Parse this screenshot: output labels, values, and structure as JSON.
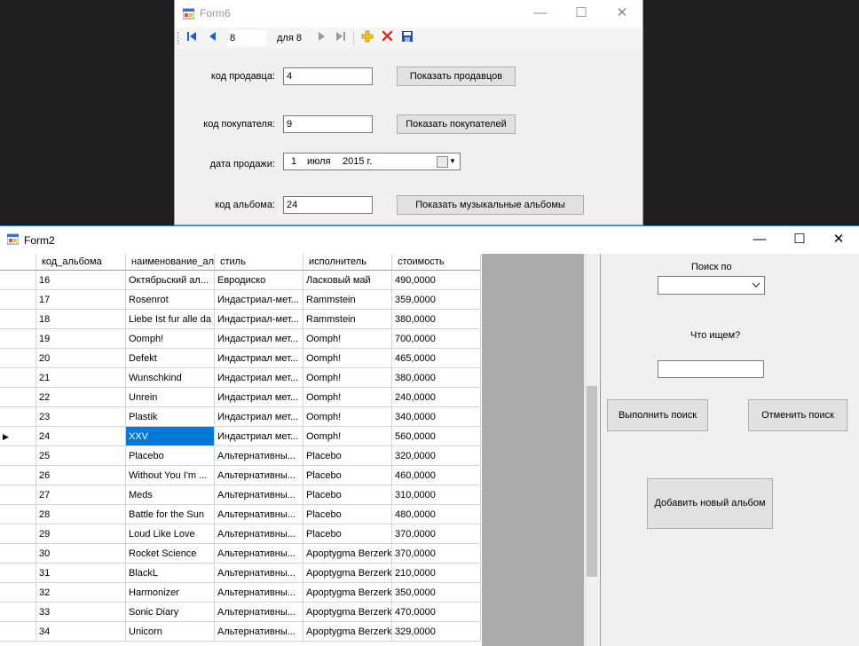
{
  "form6": {
    "title": "Form6",
    "navigator": {
      "position": "8",
      "of_label": "для 8"
    },
    "fields": [
      {
        "label": "код продавца:",
        "value": "4",
        "button": "Показать продавцов"
      },
      {
        "label": "код покупателя:",
        "value": "9",
        "button": "Показать покупателей"
      },
      {
        "label": "дата продажи:",
        "day": "1",
        "month": "июля",
        "year": "2015 г."
      },
      {
        "label": "код альбома:",
        "value": "24",
        "button": "Показать музыкальные альбомы"
      }
    ]
  },
  "form2": {
    "title": "Form2",
    "grid": {
      "columns": [
        "код_альбома",
        "наименование_ал",
        "стиль",
        "исполнитель",
        "стоимость"
      ],
      "selected_row": 8,
      "rows": [
        [
          "16",
          "Октябрьский ал...",
          "Евродиско",
          "Ласковый май",
          "490,0000"
        ],
        [
          "17",
          "Rosenrot",
          "Индастриал-мет...",
          "Rammstein",
          "359,0000"
        ],
        [
          "18",
          "Liebe Ist fur alle da",
          "Индастриал-мет...",
          "Rammstein",
          "380,0000"
        ],
        [
          "19",
          "Oomph!",
          "Индастриал мет...",
          "Oomph!",
          "700,0000"
        ],
        [
          "20",
          "Defekt",
          "Индастриал мет...",
          "Oomph!",
          "465,0000"
        ],
        [
          "21",
          "Wunschkind",
          "Индастриал мет...",
          "Oomph!",
          "380,0000"
        ],
        [
          "22",
          "Unrein",
          "Индастриал мет...",
          "Oomph!",
          "240,0000"
        ],
        [
          "23",
          "Plastik",
          "Индастриал мет...",
          "Oomph!",
          "340,0000"
        ],
        [
          "24",
          "XXV",
          "Индастриал мет...",
          "Oomph!",
          "560,0000"
        ],
        [
          "25",
          "Placebo",
          " Альтернативны...",
          "Placebo",
          "320,0000"
        ],
        [
          "26",
          "Without You I'm ...",
          " Альтернативны...",
          "Placebo",
          "460,0000"
        ],
        [
          "27",
          "Meds",
          " Альтернативны...",
          "Placebo",
          "310,0000"
        ],
        [
          "28",
          "Battle for the Sun",
          " Альтернативны...",
          "Placebo",
          "480,0000"
        ],
        [
          "29",
          "Loud Like Love",
          " Альтернативны...",
          "Placebo",
          "370,0000"
        ],
        [
          "30",
          "Rocket Science",
          " Альтернативны...",
          "Apoptygma Berzerk",
          "370,0000"
        ],
        [
          "31",
          "BlackL",
          " Альтернативны...",
          "Apoptygma Berzerk",
          "210,0000"
        ],
        [
          "32",
          "Harmonizer",
          " Альтернативны...",
          "Apoptygma Berzerk",
          "350,0000"
        ],
        [
          "33",
          "Sonic Diary",
          " Альтернативны...",
          "Apoptygma Berzerk",
          "470,0000"
        ],
        [
          "34",
          "Unicorn",
          " Альтернативны...",
          "Apoptygma Berzerk",
          "329,0000"
        ]
      ]
    },
    "search": {
      "search_by_label": "Поиск по",
      "search_by_value": "",
      "what_label": "Что ищем?",
      "what_value": "",
      "run_button": "Выполнить поиск",
      "cancel_button": "Отменить поиск",
      "add_button": "Добавить новый альбом"
    }
  }
}
